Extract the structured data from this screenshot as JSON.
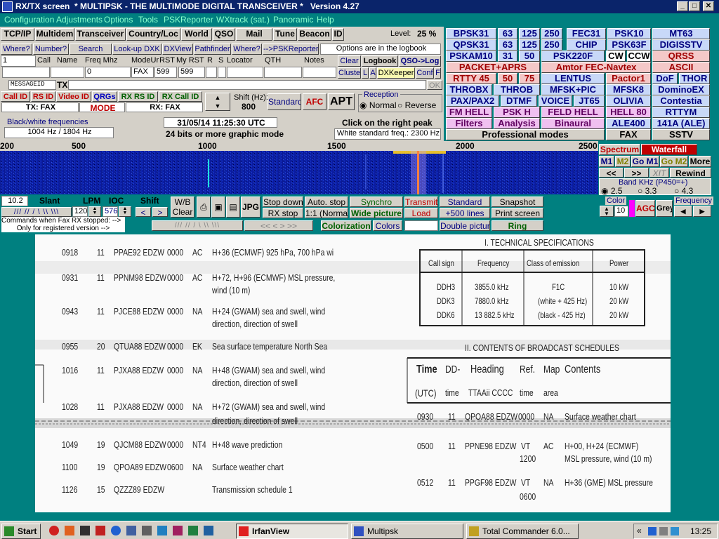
{
  "title": "RX/TX screen  * MULTIPSK - THE MULTIMODE DIGITAL TRANSCEIVER *   Version 4.27",
  "menu": [
    "Configuration",
    "Adjustments",
    "Options",
    "Tools",
    "PSKReporter",
    "WXtrack (sat.)",
    "Panoramic",
    "Help"
  ],
  "row1": [
    "TCP/IP",
    "Multidem",
    "Transceiver",
    "Country/Loc",
    "World",
    "QSO",
    "Mail",
    "Tune",
    "Beacon",
    "ID"
  ],
  "level": {
    "label": "Level:",
    "value": "25 %"
  },
  "row2": [
    "Where?",
    "Number?",
    "Search",
    "Look-up DXK",
    "DXView",
    "Pathfinder",
    "Where?",
    "-->PSKReporter"
  ],
  "logbook_note": "Options are in the logbook",
  "log": {
    "headers": [
      "Call",
      "Name",
      "Freq Mhz",
      "ModeUr",
      "RST",
      "My RST",
      "R",
      "S",
      "Locator",
      "QTH",
      "Notes"
    ],
    "call_num": "1",
    "freq": "0",
    "mode": "FAX",
    "rst": "599",
    "myrst": "599"
  },
  "logbtns": [
    "Clear",
    "Logbook",
    "QSO->Log",
    "Cluster",
    "L",
    "A",
    "DXKeeper",
    "Conf",
    "F"
  ],
  "message": {
    "id": "MESSAGEID",
    "tx": "TX",
    "ok": "OK"
  },
  "idrow": [
    "Call ID",
    "RS ID",
    "Video ID",
    "QRGs",
    "RX RS ID",
    "RX Call ID"
  ],
  "txmode": "TX: FAX",
  "mode_btn": "MODE",
  "rxmode": "RX: FAX",
  "shift": {
    "label": "Shift (Hz):",
    "value": "800"
  },
  "ctrl": [
    "Standard",
    "AFC",
    "APT"
  ],
  "reception": {
    "label": "Reception",
    "normal": "Normal",
    "reverse": "Reverse"
  },
  "bw": {
    "label": "Black/white frequencies",
    "value": "1004 Hz / 1804 Hz"
  },
  "datetime": "31/05/14 11:25:30 UTC",
  "graphic": "24 bits or more graphic mode",
  "peak": "Click on the right peak",
  "whitestd": "White standard freq.: 2300 Hz",
  "modes": [
    [
      "BPSK31",
      "63",
      "125",
      "250",
      "FEC31",
      "PSK10",
      "MT63"
    ],
    [
      "QPSK31",
      "63",
      "125",
      "250",
      "CHIP",
      "PSK63F",
      "DIGISSTV"
    ],
    [
      "PSKAM10",
      "31",
      "50",
      "PSK220F",
      "CW",
      "CCW",
      "QRSS"
    ],
    [
      "PACKET+APRS",
      "Amtor FEC-Navtex",
      "ASCII"
    ],
    [
      "RTTY 45",
      "50",
      "75",
      "LENTUS",
      "Pactor1",
      "DoF",
      "THOR"
    ],
    [
      "THROBX",
      "THROB",
      "MFSK+PIC",
      "MFSK8",
      "DominoEX"
    ],
    [
      "PAX/PAX2",
      "DTMF",
      "VOICE",
      "JT65",
      "OLIVIA",
      "Contestia"
    ],
    [
      "FM HELL",
      "PSK H",
      "FELD HELL",
      "HELL 80",
      "RTTYM"
    ],
    [
      "Filters",
      "Analysis",
      "Binaural",
      "ALE400",
      "141A (ALE)"
    ],
    [
      "Professional modes",
      "FAX",
      "SSTV"
    ]
  ],
  "scale": [
    "200",
    "500",
    "1000",
    "1500",
    "2000",
    "2500"
  ],
  "spec": {
    "spectrum": "Spectrum",
    "waterfall": "Waterfall",
    "m1": "M1",
    "m2": "M2",
    "gom1": "Go M1",
    "gom2": "Go M2",
    "more": "More",
    "xit": "XIT",
    "rewind": "Rewind",
    "band": "Band KHz (P450=+)",
    "b1": "2.5",
    "b2": "3.3",
    "b3": "4.3",
    "color": "Color",
    "colorval": "10",
    "agc": "AGC",
    "grey": "Grey",
    "freq": "Frequency"
  },
  "fax": {
    "lpmval": "10.2",
    "slant": "Slant",
    "lpm": "LPM",
    "ioc": "IOC",
    "shift": "Shift",
    "lpm_v": "120",
    "ioc_v": "576",
    "wb": "W/B",
    "clear": "Clear",
    "jpg": "JPG",
    "stopdown": "Stop down",
    "rxstop": "RX stop",
    "autostop": "Auto. stop",
    "normal": "1:1 (Normal)",
    "synchro": "Synchro",
    "wide": "Wide picture",
    "transmit": "Transmit",
    "load": "Load",
    "standard": "Standard",
    "lines": "+500 lines",
    "snapshot": "Snapshot",
    "print": "Print screen",
    "colorization": "Colorization",
    "colors": "Colors",
    "double": "Double picture",
    "ring": "Ring",
    "cmd1": "Commands when Fax RX stopped: -->",
    "cmd2": "Only for registered version -->"
  },
  "doc": {
    "title1": "I. TECHNICAL SPECIFICATIONS",
    "spec_headers": [
      "Call sign",
      "Frequency",
      "Class of emission",
      "Power"
    ],
    "spec_rows": [
      [
        "DDH3",
        "3855.0 kHz",
        "F1C",
        "10 kW"
      ],
      [
        "DDK3",
        "7880.0 kHz",
        "(white + 425 Hz)",
        "20 kW"
      ],
      [
        "DDK6",
        "13 882.5 kHz",
        "(black - 425 Hz)",
        "20 kW"
      ]
    ],
    "title2": "II. CONTENTS OF BROADCAST SCHEDULES",
    "sched_headers": [
      "Time",
      "DD-",
      "Heading",
      "Ref.",
      "Map",
      "Contents"
    ],
    "sched_sub": [
      "(UTC)",
      "time",
      "TTAAii CCCC",
      "time",
      "area"
    ],
    "left_rows": [
      [
        "0918",
        "11",
        "PPAE92 EDZW",
        "0000",
        "AC",
        "H+36 (ECMWF) 925 hPa, 700 hPa wi"
      ],
      [
        "0931",
        "11",
        "PPNM98 EDZW",
        "0000",
        "AC",
        "H+72, H+96 (ECMWF) MSL pressure,",
        "wind (10 m)"
      ],
      [
        "0943",
        "11",
        "PJCE88 EDZW",
        "0000",
        "NA",
        "H+24 (GWAM) sea and swell, wind",
        "direction, direction of swell"
      ],
      [
        "0955",
        "20",
        "QTUA88 EDZW",
        "0000",
        "EK",
        "Sea surface temperature North Sea"
      ],
      [
        "1016",
        "11",
        "PJXA88 EDZW",
        "0000",
        "NA",
        "H+48 (GWAM) sea and swell, wind",
        "direction, direction of swell"
      ],
      [
        "1028",
        "11",
        "PJXA88 EDZW",
        "0000",
        "NA",
        "H+72 (GWAM) sea and swell, wind",
        "direction, direction of swell"
      ],
      [
        "1049",
        "19",
        "QJCM88 EDZW",
        "0000",
        "NT4",
        "H+48 wave prediction"
      ],
      [
        "1100",
        "19",
        "QPOA89 EDZW",
        "0600",
        "NA",
        "Surface weather chart"
      ],
      [
        "1126",
        "15",
        "QZZZ89 EDZW",
        "",
        "",
        "Transmission schedule 1"
      ]
    ],
    "right_rows": [
      [
        "0930",
        "11",
        "QPOA88 EDZW",
        "0000",
        "NA",
        "Surface weather chart"
      ],
      [
        "0500",
        "11",
        "PPNE98 EDZW",
        "VT",
        "AC",
        "H+00, H+24 (ECMWF)",
        "1200",
        "MSL pressure, wind (10 m)"
      ],
      [
        "0512",
        "11",
        "PPGF98 EDZW",
        "VT",
        "NA",
        "H+36 (GME) MSL pressure",
        "0600"
      ]
    ]
  },
  "taskbar": {
    "start": "Start",
    "tasks": [
      "IrfanView",
      "Multipsk",
      "Total Commander 6.0..."
    ],
    "time": "13:25"
  }
}
